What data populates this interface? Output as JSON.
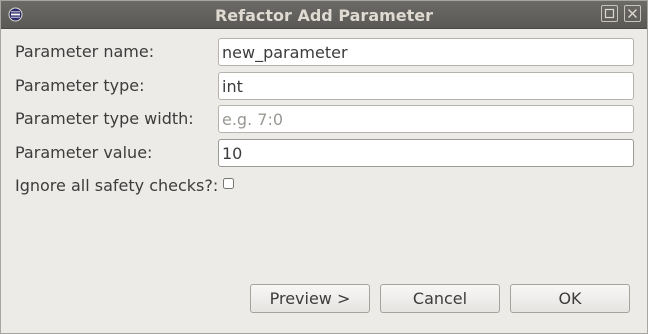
{
  "window": {
    "title": "Refactor Add Parameter",
    "menu_icon": "window-menu-icon",
    "maximize_icon": "maximize-icon",
    "close_icon": "close-icon"
  },
  "form": {
    "name": {
      "label": "Parameter name:",
      "value": "new_parameter"
    },
    "type": {
      "label": "Parameter type:",
      "value": "int"
    },
    "width": {
      "label": "Parameter type width:",
      "value": "",
      "placeholder": "e.g. 7:0"
    },
    "param_value": {
      "label": "Parameter value:",
      "value": "10"
    },
    "ignore_checks": {
      "label": "Ignore all safety checks?:",
      "checked": false
    }
  },
  "buttons": {
    "preview": "Preview >",
    "cancel": "Cancel",
    "ok": "OK"
  },
  "colors": {
    "titlebar": "#5f5e5a",
    "title_text": "#dfdbd2",
    "dialog_bg": "#edebe8"
  }
}
